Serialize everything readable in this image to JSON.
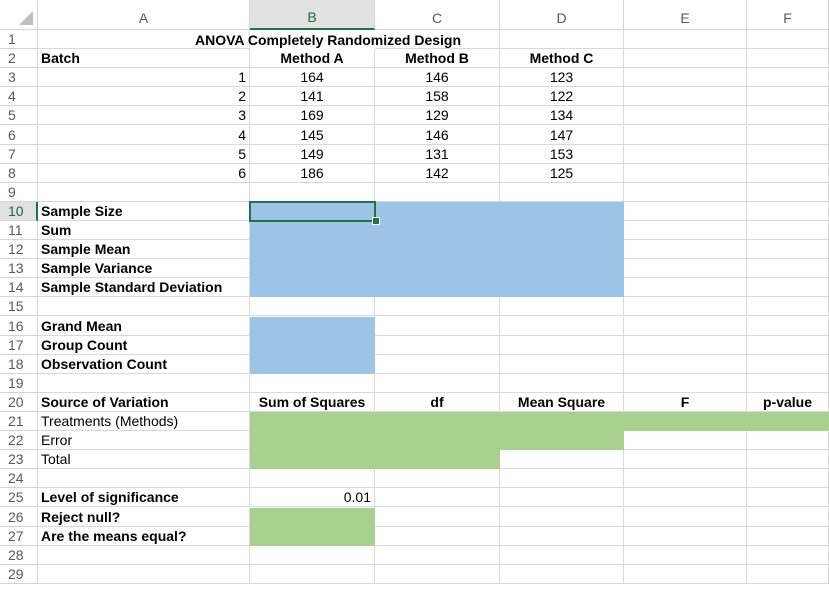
{
  "columns": [
    "A",
    "B",
    "C",
    "D",
    "E",
    "F"
  ],
  "rows": [
    "1",
    "2",
    "3",
    "4",
    "5",
    "6",
    "7",
    "8",
    "9",
    "10",
    "11",
    "12",
    "13",
    "14",
    "15",
    "16",
    "17",
    "18",
    "19",
    "20",
    "21",
    "22",
    "23",
    "24",
    "25",
    "26",
    "27",
    "28",
    "29"
  ],
  "selected_cell": "B10",
  "cells": {
    "A2": "Batch",
    "B1": "ANOVA Completely Randomized Design",
    "B2": "Method A",
    "C2": "Method B",
    "D2": "Method C",
    "A3": "1",
    "B3": "164",
    "C3": "146",
    "D3": "123",
    "A4": "2",
    "B4": "141",
    "C4": "158",
    "D4": "122",
    "A5": "3",
    "B5": "169",
    "C5": "129",
    "D5": "134",
    "A6": "4",
    "B6": "145",
    "C6": "146",
    "D6": "147",
    "A7": "5",
    "B7": "149",
    "C7": "131",
    "D7": "153",
    "A8": "6",
    "B8": "186",
    "C8": "142",
    "D8": "125",
    "A10": "Sample Size",
    "A11": "Sum",
    "A12": "Sample Mean",
    "A13": "Sample Variance",
    "A14": "Sample Standard Deviation",
    "A16": "Grand Mean",
    "A17": "Group Count",
    "A18": "Observation Count",
    "A20": "Source of Variation",
    "B20": "Sum of Squares",
    "C20": "df",
    "D20": "Mean Square",
    "E20": "F",
    "F20": "p-value",
    "A21": "Treatments (Methods)",
    "A22": "Error",
    "A23": "Total",
    "A25": "Level of significance",
    "B25": "0.01",
    "A26": "Reject null?",
    "A27": "Are the means equal?"
  },
  "colors": {
    "input_fill": "#9dc3e6",
    "output_fill": "#a9d08e",
    "selection": "#217346"
  }
}
